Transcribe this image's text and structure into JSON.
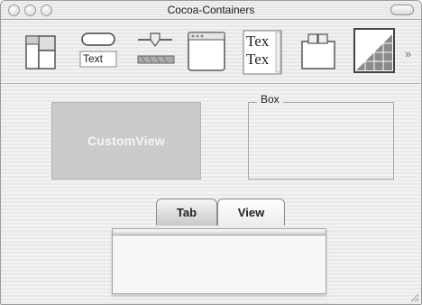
{
  "window": {
    "title": "Cocoa-Containers"
  },
  "toolbar": {
    "items": [
      {
        "icon": "split-view-icon"
      },
      {
        "icon": "button-text-icon",
        "label": "Text"
      },
      {
        "icon": "slider-icon"
      },
      {
        "icon": "window-icon"
      },
      {
        "icon": "text-view-icon",
        "lines": [
          "Tex",
          "Tex"
        ]
      },
      {
        "icon": "box-icon"
      },
      {
        "icon": "custom-graph-icon"
      }
    ],
    "more": "»"
  },
  "custom_view": {
    "label": "CustomView"
  },
  "box": {
    "label": "Box"
  },
  "tabview": {
    "tabs": [
      "Tab",
      "View"
    ],
    "selected": 0
  }
}
